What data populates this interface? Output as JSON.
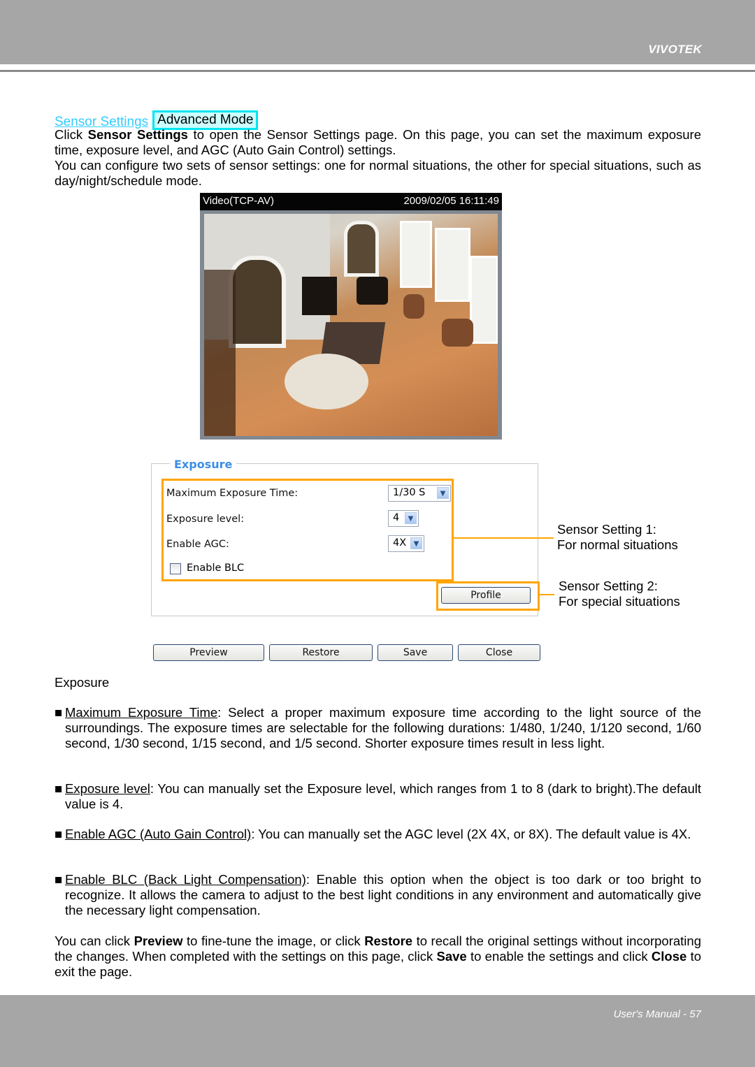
{
  "header": {
    "brand": "VIVOTEK"
  },
  "footer": {
    "page_label": "User's Manual - 57"
  },
  "section": {
    "link_label": "Sensor Settings",
    "mode_badge": "Advanced Mode"
  },
  "intro": {
    "p1_pre": "Click ",
    "p1_bold": "Sensor Settings",
    "p1_post": " to open the Sensor Settings page. On this page, you can set the maximum exposure time, exposure level, and AGC (Auto Gain Control) settings.",
    "p2": "You can configure two sets of sensor settings: one for normal situations, the other for special situations, such as day/night/schedule mode."
  },
  "video": {
    "title": "Video(TCP-AV)",
    "timestamp": "2009/02/05 16:11:49"
  },
  "exposure_panel": {
    "legend": "Exposure",
    "fields": [
      {
        "label": "Maximum Exposure Time:",
        "value": "1/30 S"
      },
      {
        "label": "Exposure level:",
        "value": "4"
      },
      {
        "label": "Enable AGC:",
        "value": "4X"
      }
    ],
    "blc_label": "Enable BLC",
    "blc_checked": false,
    "profile_button": "Profile"
  },
  "buttons": {
    "preview": "Preview",
    "restore": "Restore",
    "save": "Save",
    "close": "Close"
  },
  "callouts": {
    "setting1_line1": "Sensor Setting 1:",
    "setting1_line2": "For normal situations",
    "setting2_line1": "Sensor Setting 2:",
    "setting2_line2": "For special situations"
  },
  "body": {
    "exposure_heading": "Exposure",
    "bullets": [
      {
        "term": "Maximum Exposure Time",
        "text": ": Select a proper maximum exposure time according to the light source of the surroundings. The exposure times are selectable for the following durations: 1/480, 1/240, 1/120 second, 1/60 second, 1/30 second, 1/15 second, and 1/5 second. Shorter exposure times result in less light."
      },
      {
        "term": "Exposure level",
        "text": ": You can manually set the Exposure level, which ranges from 1 to 8 (dark to bright).The default value is 4."
      },
      {
        "term": "Enable AGC (Auto Gain Control)",
        "text": ": You can manually set the AGC level (2X 4X, or 8X). The default value is 4X."
      },
      {
        "term": "Enable BLC (Back Light Compensation)",
        "text": ": Enable this option when the object is too dark or too bright to recognize. It allows the camera to adjust to the best light conditions in any environment and automatically give the necessary light compensation."
      }
    ],
    "bullet_glyph": "■",
    "closing": {
      "t1": "You can click ",
      "b1": "Preview",
      "t2": " to fine-tune the image, or click ",
      "b2": "Restore",
      "t3": " to recall the original settings without incorporating the changes. When completed with the settings on this page, click ",
      "b3": "Save",
      "t4": " to enable the settings and click ",
      "b4": "Close",
      "t5": " to exit the page."
    }
  },
  "colors": {
    "header_gray": "#a6a6a6",
    "link_cyan": "#33ccff",
    "badge_border": "#00e5f0",
    "highlight_orange": "#ffa500",
    "legend_blue": "#3d8ee6"
  }
}
